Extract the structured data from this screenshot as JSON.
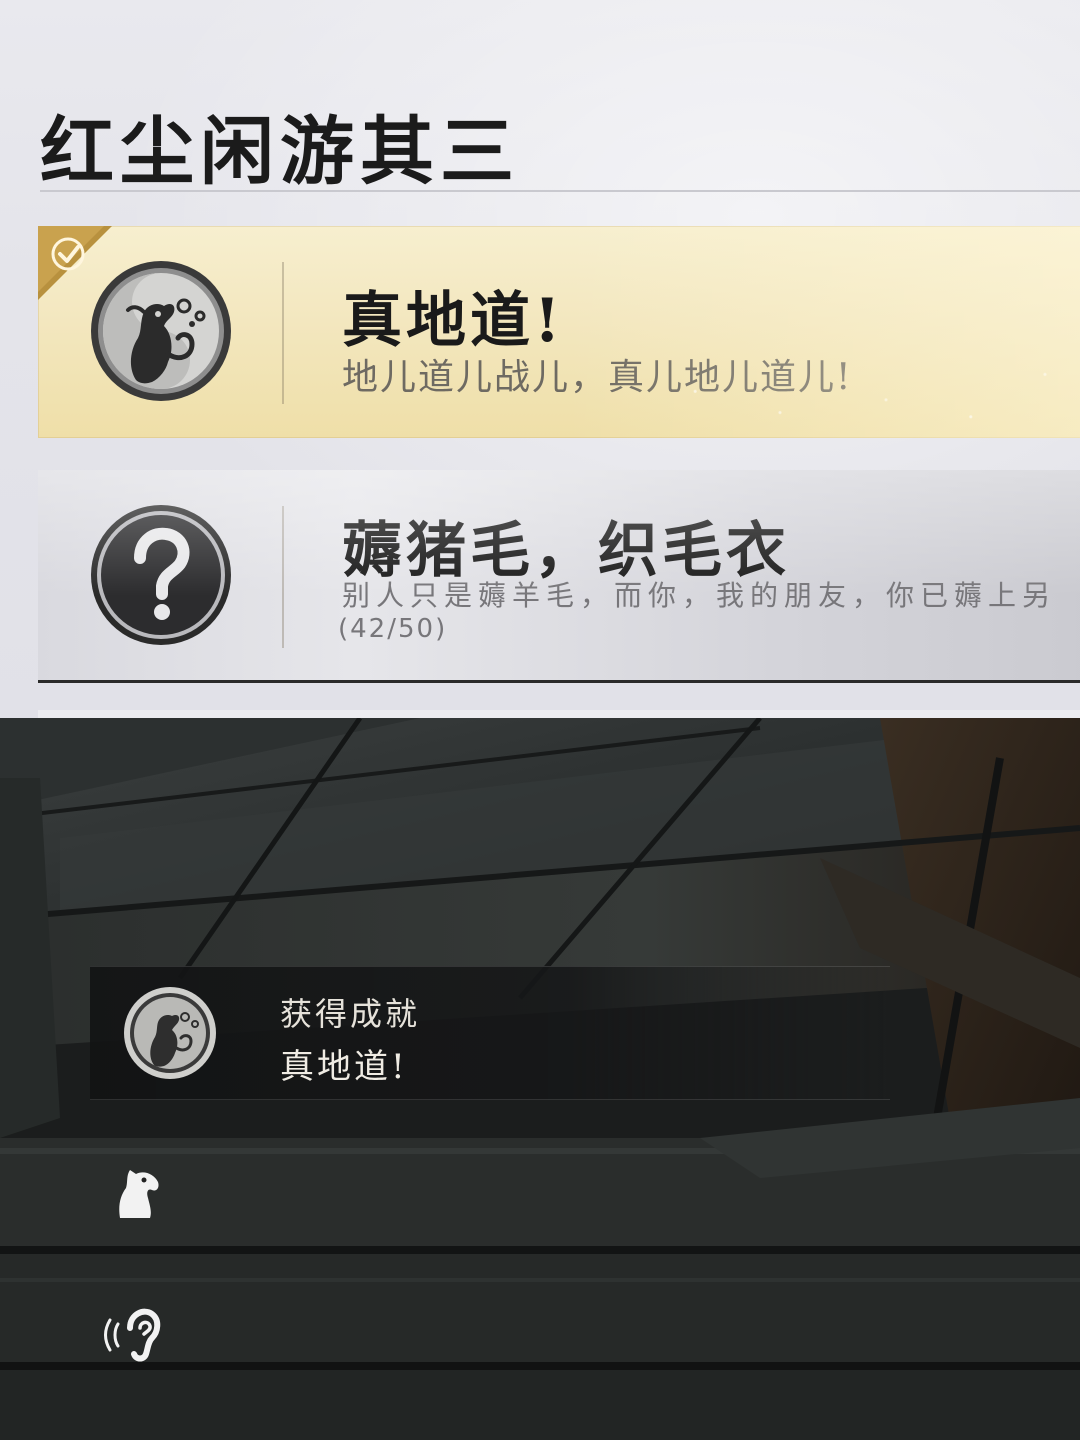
{
  "achievements_panel": {
    "section_title": "红尘闲游其三",
    "items": [
      {
        "state": "unlocked",
        "icon": "rat-emblem-icon",
        "title": "真地道!",
        "description": "地儿道儿战儿，真儿地儿道儿!"
      },
      {
        "state": "locked",
        "icon": "question-mark-icon",
        "title": "薅猪毛，织毛衣",
        "description": "别人只是薅羊毛，而你，我的朋友，你已薅上另",
        "progress": "(42/50)"
      }
    ]
  },
  "toast": {
    "icon": "rat-emblem-icon",
    "label": "获得成就",
    "achievement_name": "真地道!"
  },
  "hud": {
    "icons": [
      "horse-head-icon",
      "ear-listen-icon"
    ]
  },
  "colors": {
    "unlocked_card": "#f3e7bf",
    "locked_card": "#d9d9df",
    "panel_bg": "#e6e6eb",
    "toast_bg": "#141516"
  }
}
